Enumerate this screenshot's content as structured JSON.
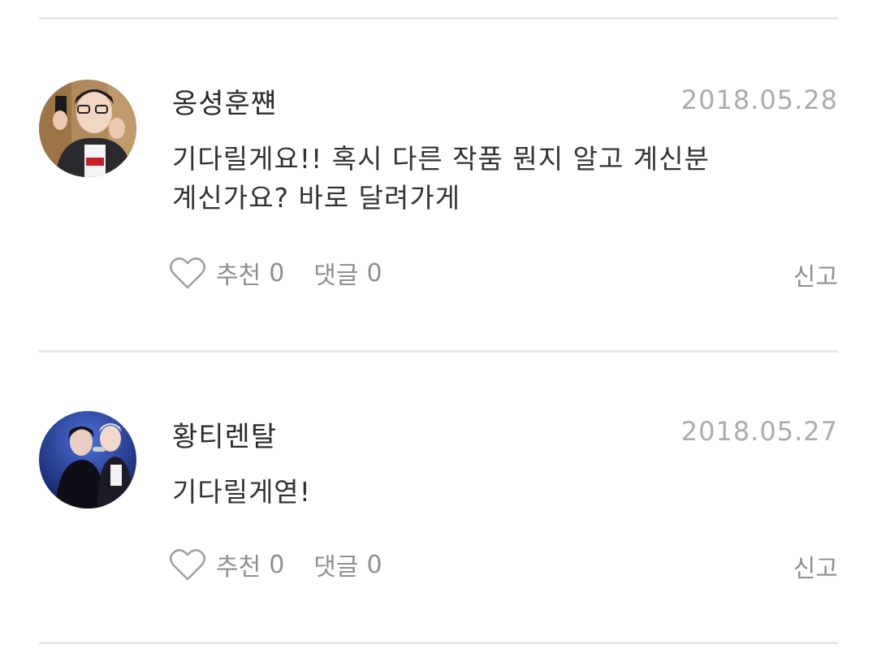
{
  "comments": [
    {
      "username": "옹셩훈쨴",
      "date": "2018.05.28",
      "text_line1": "기다릴게요!! 혹시 다른 작품 뭔지 알고 계신분",
      "text_line2": "계신가요? 바로 달려가게",
      "like_label": "추천",
      "like_count": "0",
      "reply_label": "댓글",
      "reply_count": "0",
      "report_label": "신고"
    },
    {
      "username": "황티렌탈",
      "date": "2018.05.27",
      "text_line1": "기다릴게엳!",
      "like_label": "추천",
      "like_count": "0",
      "reply_label": "댓글",
      "reply_count": "0",
      "report_label": "신고"
    }
  ],
  "icons": {
    "like": "heart-outline-icon"
  },
  "colors": {
    "date": "#a7adb0",
    "action": "#8a9094",
    "divider": "#e3e8ea"
  }
}
